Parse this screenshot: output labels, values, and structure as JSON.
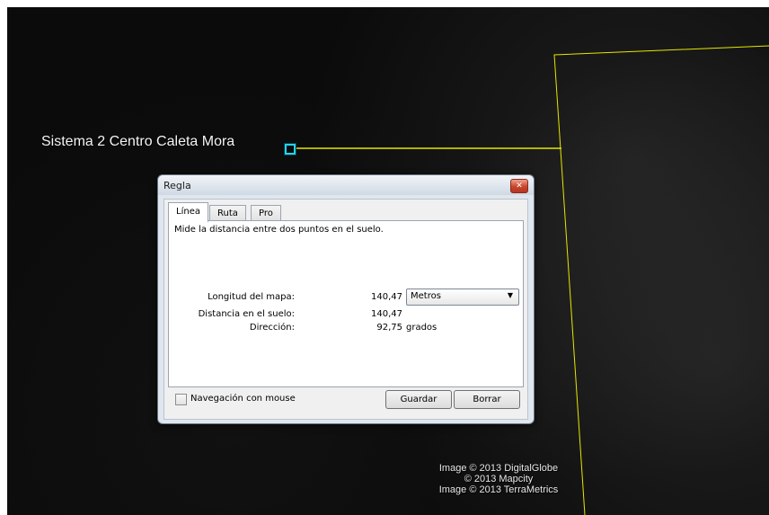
{
  "map": {
    "placemark_label": "Sistema 2 Centro Caleta Mora",
    "credits": [
      "Image © 2013 DigitalGlobe",
      "© 2013 Mapcity",
      "Image © 2013 TerraMetrics"
    ],
    "ruler_line_color": "#e6e600"
  },
  "dialog": {
    "title": "Regla",
    "close_icon": "close-icon",
    "tabs": [
      {
        "label": "Línea",
        "active": true
      },
      {
        "label": "Ruta",
        "active": false
      },
      {
        "label": "Pro",
        "active": false
      }
    ],
    "description": "Mide la distancia entre dos puntos en el suelo.",
    "map_length": {
      "label": "Longitud del mapa:",
      "value": "140,47"
    },
    "ground_distance": {
      "label": "Distancia en el suelo:",
      "value": "140,47"
    },
    "heading": {
      "label": "Dirección:",
      "value": "92,75",
      "unit": "grados"
    },
    "unit_select": {
      "value": "Metros",
      "icon": "chevron-down-icon"
    },
    "mouse_navigation": {
      "label": "Navegación con mouse",
      "checked": false
    },
    "save_label": "Guardar",
    "clear_label": "Borrar"
  }
}
